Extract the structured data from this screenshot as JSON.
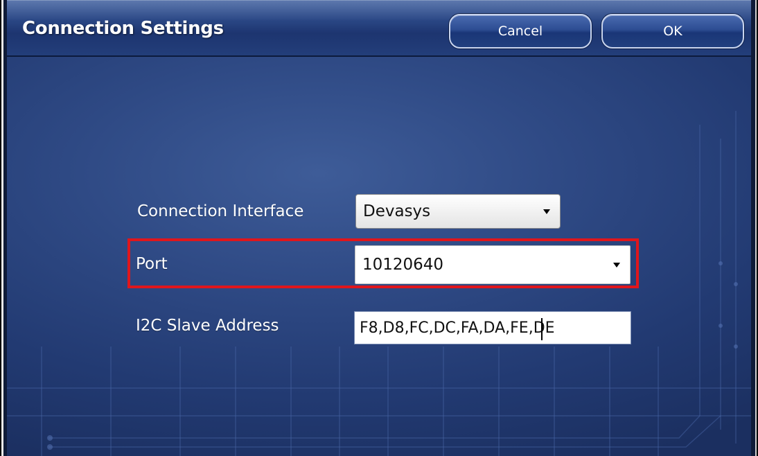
{
  "window": {
    "title": "Connection Settings"
  },
  "toolbar": {
    "cancel_label": "Cancel",
    "ok_label": "OK"
  },
  "form": {
    "connection_interface": {
      "label": "Connection Interface",
      "value": "Devasys"
    },
    "port": {
      "label": "Port",
      "value": "10120640"
    },
    "i2c_slave_address": {
      "label": "I2C Slave Address",
      "value": "F8,D8,FC,DC,FA,DA,FE,DE"
    }
  },
  "icons": {
    "dropdown_arrow": "chevron-down-icon"
  },
  "colors": {
    "background": "#2b4581",
    "titlebar": "#223d79",
    "highlight": "#e0161c",
    "text": "#ffffff"
  }
}
